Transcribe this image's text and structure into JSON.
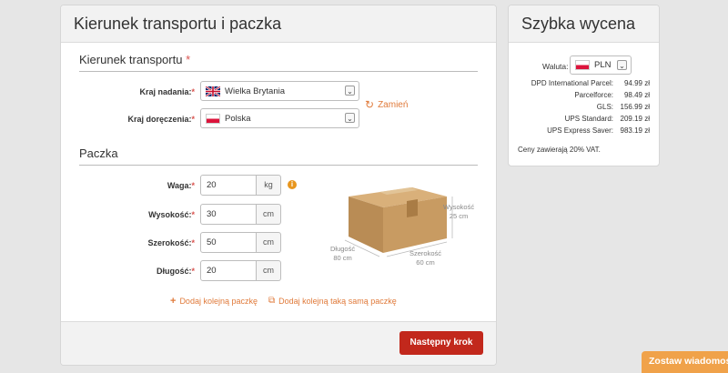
{
  "main": {
    "title": "Kierunek transportu i paczka",
    "direction_section": {
      "title": "Kierunek transportu",
      "required_mark": "*"
    },
    "from": {
      "label": "Kraj nadania:",
      "value": "Wielka Brytania",
      "flag": "uk-flag"
    },
    "to": {
      "label": "Kraj doręczenia:",
      "value": "Polska",
      "flag": "pl-flag"
    },
    "swap_label": "Zamień",
    "package_section": {
      "title": "Paczka"
    },
    "fields": [
      {
        "label": "Waga:",
        "value": "20",
        "unit": "kg"
      },
      {
        "label": "Wysokość:",
        "value": "30",
        "unit": "cm"
      },
      {
        "label": "Szerokość:",
        "value": "50",
        "unit": "cm"
      },
      {
        "label": "Długość:",
        "value": "20",
        "unit": "cm"
      }
    ],
    "box_dims": {
      "height": "Wysokość\n25 cm",
      "length": "Długość\n80 cm",
      "width": "Szerokość\n60 cm"
    },
    "add_package": "Dodaj kolejną paczkę",
    "add_same_package": "Dodaj kolejną taką samą paczkę",
    "next_button": "Następny krok"
  },
  "side": {
    "title": "Szybka wycena",
    "currency_label": "Waluta:",
    "currency_value": "PLN",
    "quotes": [
      {
        "name": "DPD International Parcel:",
        "price": "94.99 zł"
      },
      {
        "name": "Parcelforce:",
        "price": "98.49 zł"
      },
      {
        "name": "GLS:",
        "price": "156.99 zł"
      },
      {
        "name": "UPS Standard:",
        "price": "209.19 zł"
      },
      {
        "name": "UPS Express Saver:",
        "price": "983.19 zł"
      }
    ],
    "vat_note": "Ceny zawierają 20% VAT."
  },
  "chat_tab": "Zostaw wiadomoś",
  "colors": {
    "accent": "#e07a3a",
    "primary_button": "#c2281c",
    "chat_tab": "#f0a24a"
  }
}
